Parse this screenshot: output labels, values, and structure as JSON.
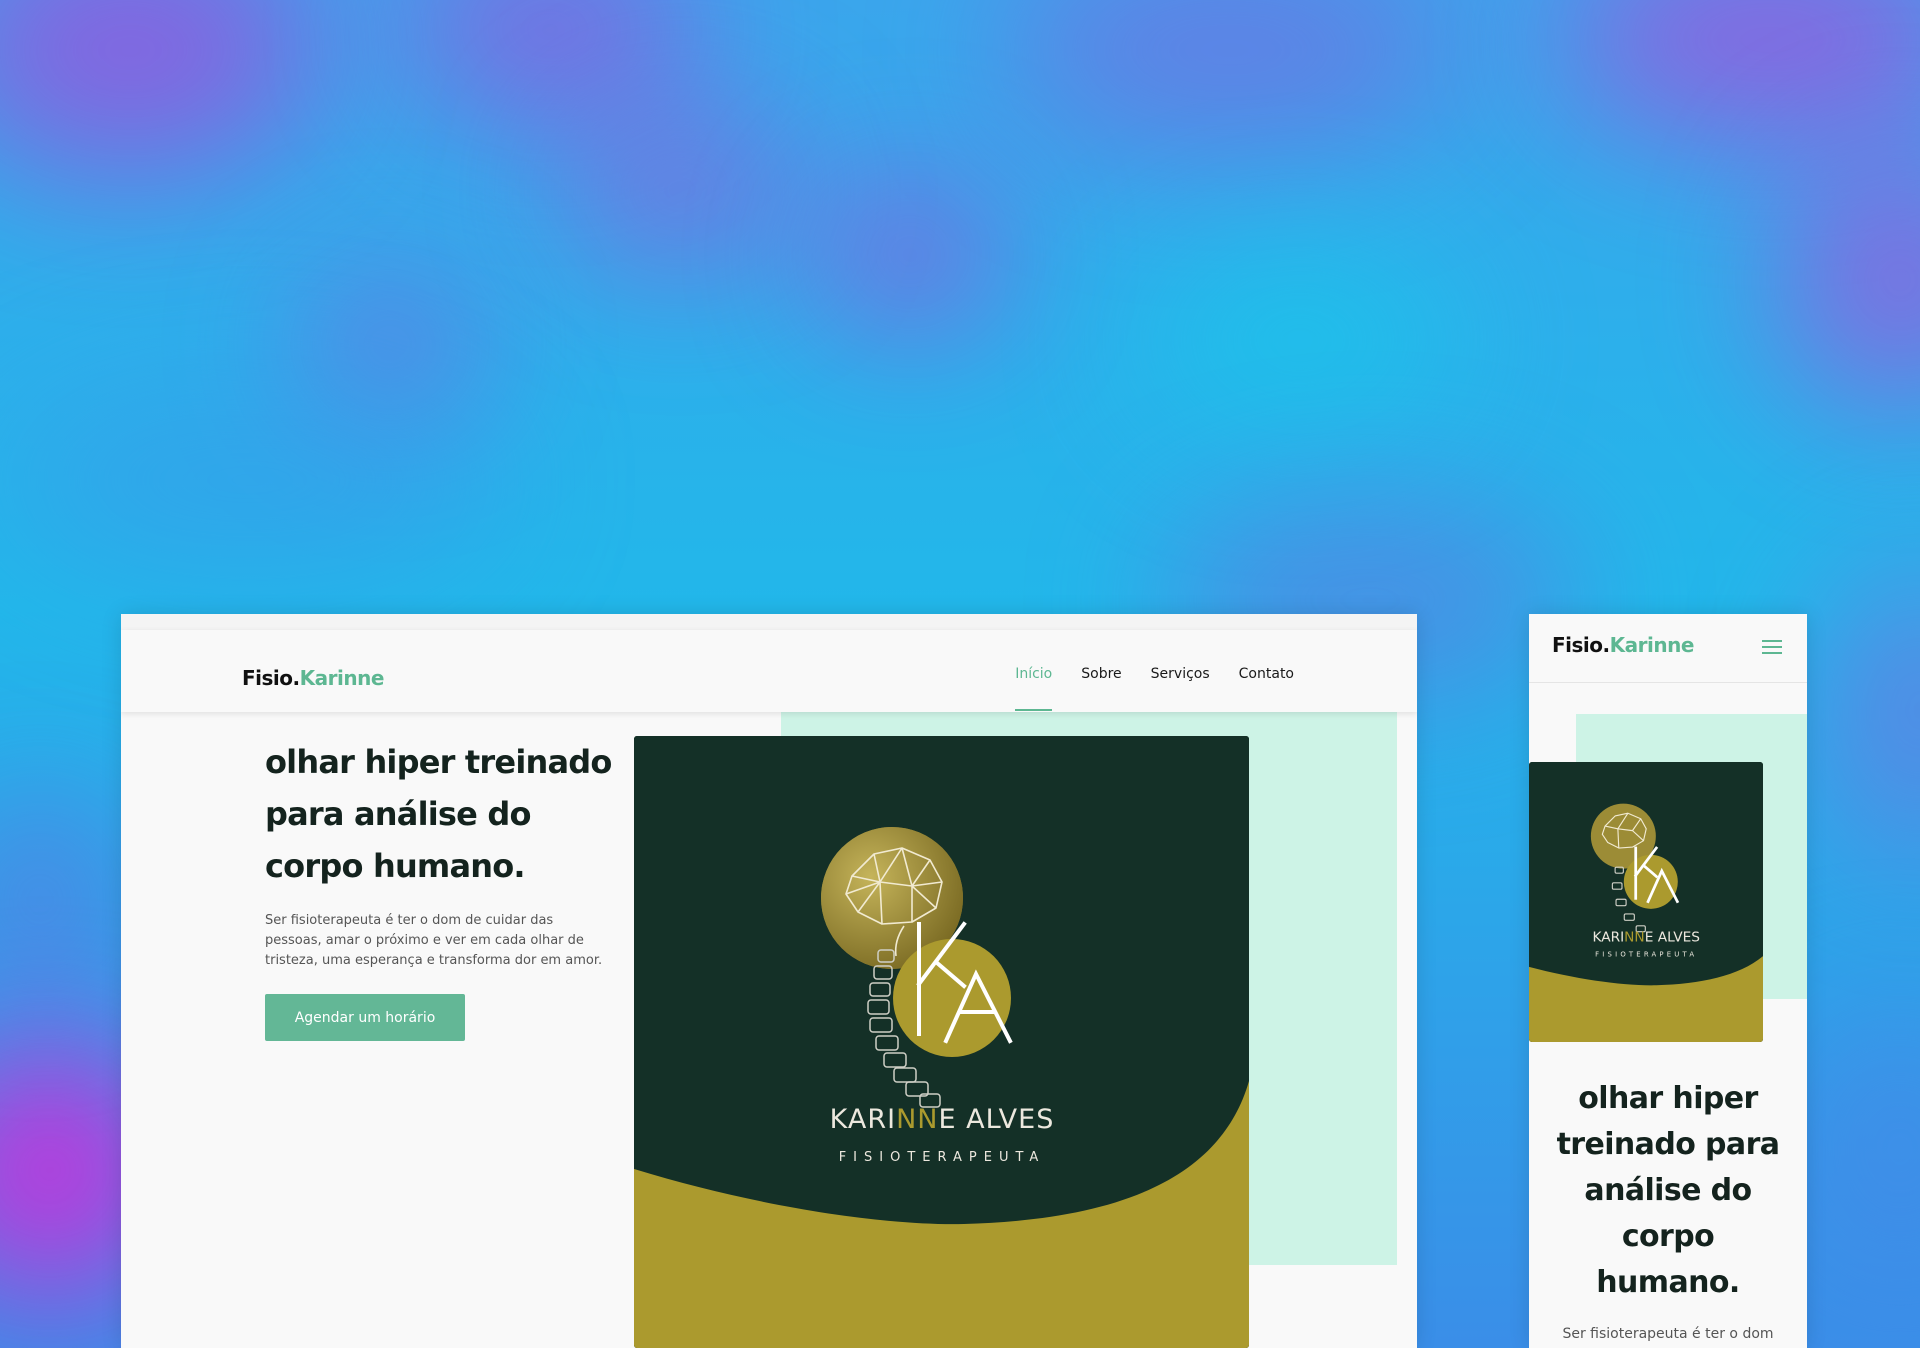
{
  "site": {
    "brand_prefix": "Fisio.",
    "brand_name": "Karinne",
    "accent_color": "#5db792",
    "nav": [
      {
        "label": "Início",
        "active": true
      },
      {
        "label": "Sobre",
        "active": false
      },
      {
        "label": "Serviços",
        "active": false
      },
      {
        "label": "Contato",
        "active": false
      }
    ],
    "menu_icon": "hamburger-menu-icon"
  },
  "hero": {
    "title_lines": [
      "olhar hiper treinado",
      "para análise do",
      "corpo humano."
    ],
    "description_lines": [
      "Ser fisioterapeuta é ter o dom de cuidar das",
      "pessoas, amar o próximo e ver em cada olhar de",
      "tristeza, uma esperança e transforma dor em amor."
    ],
    "cta_label": "Agendar um horário"
  },
  "logo": {
    "monogram": "KA",
    "name_part1": "KARI",
    "name_highlight": "NN",
    "name_part2": "E ALVES",
    "subtitle": "FISIOTERAPEUTA",
    "colors": {
      "dark_green": "#143027",
      "olive": "#ab9a2e",
      "mint": "#cdf3e6"
    }
  },
  "mobile": {
    "title_lines": [
      "olhar hiper",
      "treinado para",
      "análise do",
      "corpo",
      "humano."
    ],
    "description_snippet": "Ser fisioterapeuta é ter o dom"
  }
}
